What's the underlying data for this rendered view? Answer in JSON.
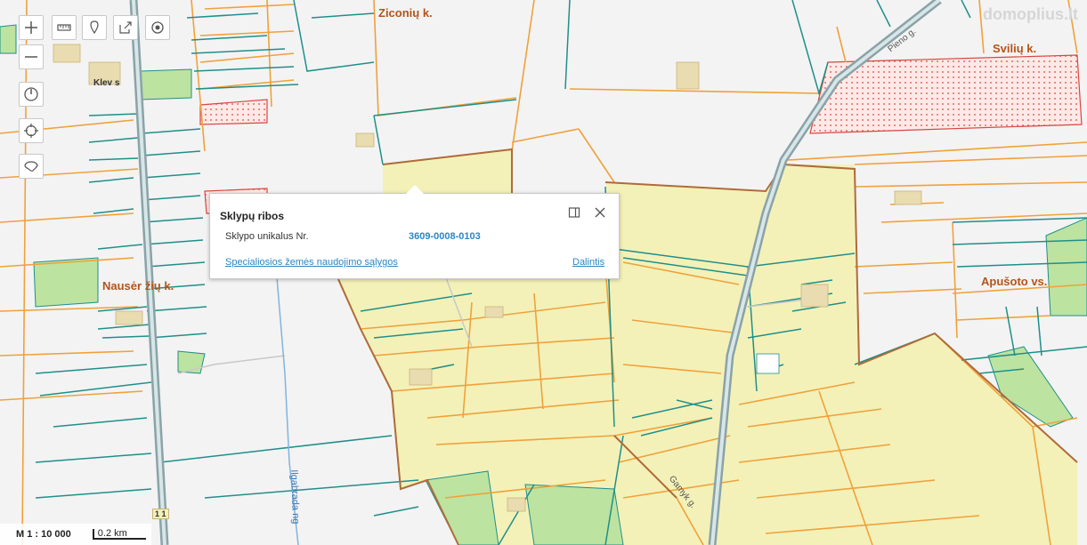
{
  "toolbar": {
    "zoom_in": "plus-icon",
    "zoom_out": "minus-icon",
    "measure": "ruler-icon",
    "marker": "pin-icon",
    "export": "export-icon",
    "locate": "target-icon",
    "compass": "compass-icon",
    "gps": "crosshair-icon",
    "region": "lithuania-outline-icon"
  },
  "watermark": "domoplius.lt",
  "places": {
    "ziconiu": "Ziconių k.",
    "sviliu": "Svilių k.",
    "nauseriu": "Nausėr žių k.",
    "apusoto": "Apušoto vs."
  },
  "labels": {
    "klev": "Klev   s",
    "pieno": "Pieno g.",
    "gamyklos": "Gamyk g.",
    "ilgabrada": "Ilgabrada  ng",
    "road_number": "1 1"
  },
  "popup": {
    "title": "Sklypų ribos",
    "field_label": "Sklypo unikalus Nr.",
    "field_value": "3609-0008-0103",
    "conditions_link": "Specialiosios žemės naudojimo sąlygos",
    "share_link": "Dalintis"
  },
  "scale": {
    "ratio": "M 1 : 10 000",
    "bar_label": "0.2 km"
  },
  "colors": {
    "background": "#f3f3f3",
    "parcel_orange": "#f0a13a",
    "parcel_teal": "#1f8f8a",
    "parcel_brown": "#b06b3a",
    "fill_yellow": "#f3f1b8",
    "fill_green": "#bde3a0",
    "road_gray": "#8aa3a8",
    "restricted_red": "#d9463f",
    "place_label": "#b4541a",
    "link_blue": "#2a86c5"
  }
}
